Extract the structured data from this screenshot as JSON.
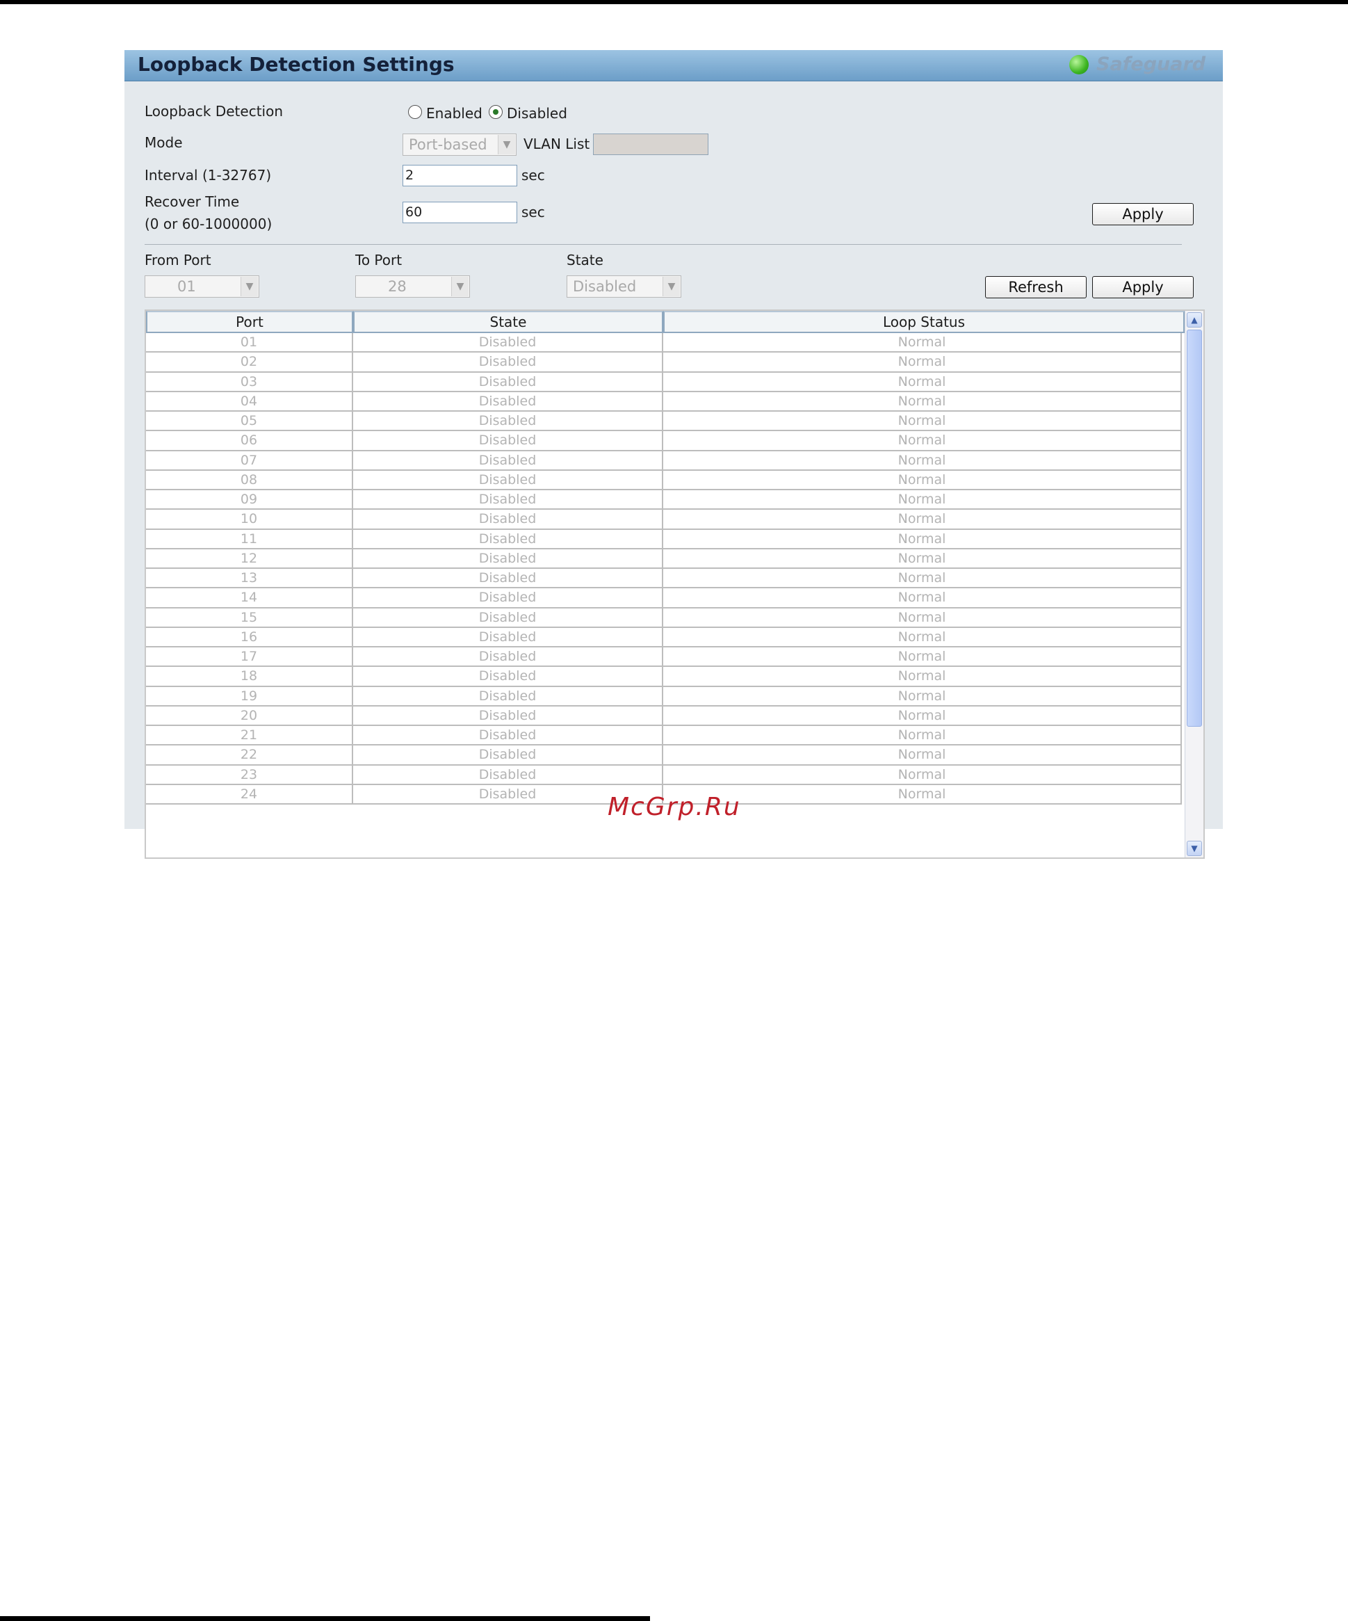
{
  "title": "Loopback Detection Settings",
  "safeguard": {
    "label": "Safeguard",
    "status_color": "#3cb521"
  },
  "global": {
    "loopback_detection_label": "Loopback Detection",
    "enabled_label": "Enabled",
    "disabled_label": "Disabled",
    "selected": "Disabled",
    "mode_label": "Mode",
    "mode_value": "Port-based",
    "vlan_list_label": "VLAN List",
    "vlan_list_value": "",
    "interval_label": "Interval (1-32767)",
    "interval_value": "2",
    "interval_unit": "sec",
    "recover_label_line1": "Recover Time",
    "recover_label_line2": "(0 or 60-1000000)",
    "recover_value": "60",
    "recover_unit": "sec",
    "apply_label": "Apply"
  },
  "port_settings": {
    "from_port_label": "From Port",
    "from_port_value": "01",
    "to_port_label": "To Port",
    "to_port_value": "28",
    "state_label": "State",
    "state_value": "Disabled",
    "refresh_label": "Refresh",
    "apply_label": "Apply"
  },
  "table": {
    "headers": [
      "Port",
      "State",
      "Loop Status"
    ],
    "rows": [
      [
        "01",
        "Disabled",
        "Normal"
      ],
      [
        "02",
        "Disabled",
        "Normal"
      ],
      [
        "03",
        "Disabled",
        "Normal"
      ],
      [
        "04",
        "Disabled",
        "Normal"
      ],
      [
        "05",
        "Disabled",
        "Normal"
      ],
      [
        "06",
        "Disabled",
        "Normal"
      ],
      [
        "07",
        "Disabled",
        "Normal"
      ],
      [
        "08",
        "Disabled",
        "Normal"
      ],
      [
        "09",
        "Disabled",
        "Normal"
      ],
      [
        "10",
        "Disabled",
        "Normal"
      ],
      [
        "11",
        "Disabled",
        "Normal"
      ],
      [
        "12",
        "Disabled",
        "Normal"
      ],
      [
        "13",
        "Disabled",
        "Normal"
      ],
      [
        "14",
        "Disabled",
        "Normal"
      ],
      [
        "15",
        "Disabled",
        "Normal"
      ],
      [
        "16",
        "Disabled",
        "Normal"
      ],
      [
        "17",
        "Disabled",
        "Normal"
      ],
      [
        "18",
        "Disabled",
        "Normal"
      ],
      [
        "19",
        "Disabled",
        "Normal"
      ],
      [
        "20",
        "Disabled",
        "Normal"
      ],
      [
        "21",
        "Disabled",
        "Normal"
      ],
      [
        "22",
        "Disabled",
        "Normal"
      ],
      [
        "23",
        "Disabled",
        "Normal"
      ],
      [
        "24",
        "Disabled",
        "Normal"
      ]
    ]
  },
  "watermark": "McGrp.Ru"
}
